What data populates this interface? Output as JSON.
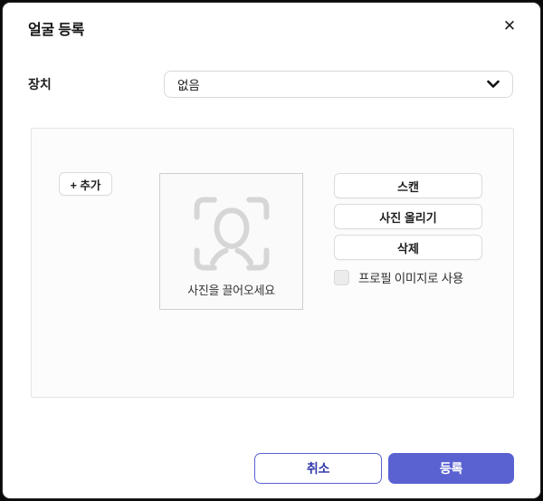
{
  "dialog": {
    "title": "얼굴 등록",
    "close_label": "✕"
  },
  "device": {
    "label": "장치",
    "selected_value": "없음"
  },
  "panel": {
    "add_button_label": "+ 추가",
    "drop_area": {
      "hint": "사진을 끌어오세요"
    },
    "actions": [
      {
        "label": "스캔"
      },
      {
        "label": "사진 올리기"
      },
      {
        "label": "삭제"
      }
    ],
    "profile_checkbox": {
      "label": "프로필 이미지로 사용",
      "checked": false
    }
  },
  "footer": {
    "cancel_label": "취소",
    "submit_label": "등록"
  },
  "colors": {
    "accent": "#5a62d2",
    "accent_text_dark": "#343cab",
    "panel_border": "#e3e3e3",
    "icon_gray": "#d6d6d6"
  }
}
